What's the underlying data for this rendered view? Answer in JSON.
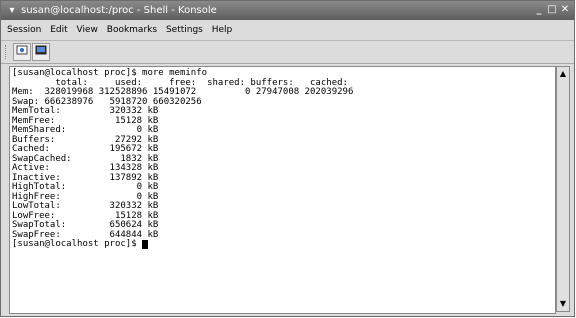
{
  "window": {
    "title": "susan@localhost:/proc - Shell - Konsole",
    "sysmenu_icon": "▾",
    "minimize": "_",
    "maximize": "□",
    "close": "✕"
  },
  "menubar": [
    "Session",
    "Edit",
    "View",
    "Bookmarks",
    "Settings",
    "Help"
  ],
  "toolbar": {
    "new_session_icon": "terminal-new-icon",
    "konsole_icon": "konsole-icon"
  },
  "terminal": {
    "lines": [
      "[susan@localhost proc]$ more meminfo",
      "        total:     used:     free:  shared: buffers:   cached:",
      "Mem:  328019968 312528896 15491072         0 27947008 202039296",
      "Swap: 666238976   5918720 660320256",
      "MemTotal:         320332 kB",
      "MemFree:           15128 kB",
      "MemShared:             0 kB",
      "Buffers:           27292 kB",
      "Cached:           195672 kB",
      "SwapCached:         1832 kB",
      "Active:           134328 kB",
      "Inactive:         137892 kB",
      "HighTotal:             0 kB",
      "HighFree:              0 kB",
      "LowTotal:         320332 kB",
      "LowFree:           15128 kB",
      "SwapTotal:        650624 kB",
      "SwapFree:         644844 kB"
    ],
    "prompt": "[susan@localhost proc]$ "
  },
  "scrollbar": {
    "up": "▲",
    "down": "▼"
  }
}
